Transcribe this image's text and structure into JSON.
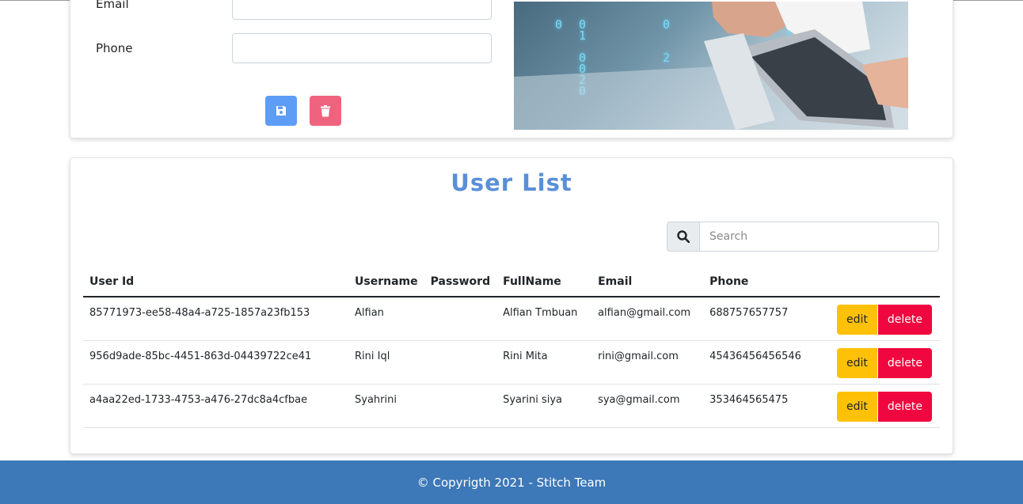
{
  "form": {
    "email_label": "Email",
    "phone_label": "Phone",
    "email_value": "",
    "phone_value": ""
  },
  "hero": {
    "code_columns": [
      "0",
      "0\n1\n\n0\n0\n2\n0",
      "0\n\n\n2",
      "0\n1",
      "2"
    ]
  },
  "user_list": {
    "title": "User List",
    "search_placeholder": "Search",
    "columns": [
      "User Id",
      "Username",
      "Password",
      "FullName",
      "Email",
      "Phone",
      ""
    ],
    "rows": [
      {
        "id": "85771973-ee58-48a4-a725-1857a23fb153",
        "username": "Alfian",
        "password": "",
        "fullname": "Alfian Tmbuan",
        "email": "alfian@gmail.com",
        "phone": "688757657757"
      },
      {
        "id": "956d9ade-85bc-4451-863d-04439722ce41",
        "username": "Rini Iql",
        "password": "",
        "fullname": "Rini Mita",
        "email": "rini@gmail.com",
        "phone": "45436456456546"
      },
      {
        "id": "a4aa22ed-1733-4753-a476-27dc8a4cfbae",
        "username": "Syahrini",
        "password": "",
        "fullname": "Syarini siya",
        "email": "sya@gmail.com",
        "phone": "353464565475"
      }
    ],
    "edit_label": "edit",
    "delete_label": "delete"
  },
  "footer": {
    "text": "© Copyrigth 2021 - Stitch Team"
  },
  "colors": {
    "accent": "#5a8fd8",
    "save": "#5d9df5",
    "trash": "#f0637e",
    "edit": "#ffc107",
    "delete": "#f0073f",
    "footer": "#3d78b8"
  }
}
